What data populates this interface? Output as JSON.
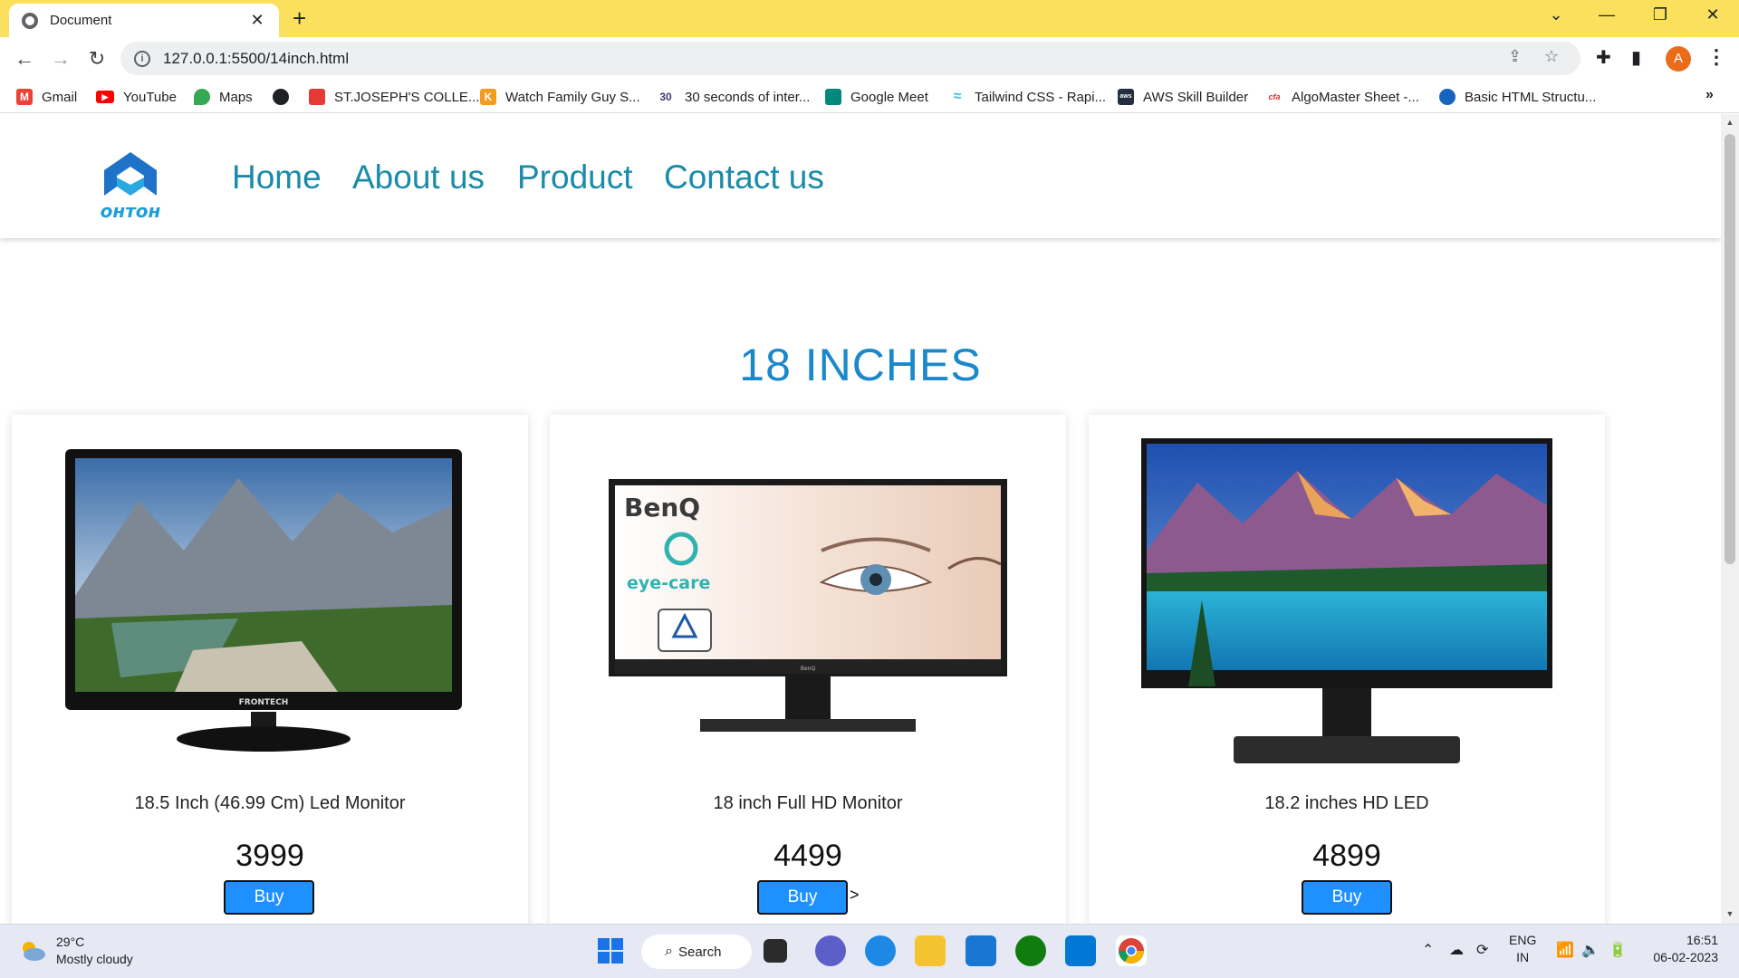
{
  "browser": {
    "tab_title": "Document",
    "url": "127.0.0.1:5500/14inch.html",
    "profile_initial": "A",
    "bookmarks": [
      {
        "label": "Gmail",
        "icon": "gmail-icon",
        "color": "#ea4335"
      },
      {
        "label": "YouTube",
        "icon": "youtube-icon",
        "color": "#ff0000"
      },
      {
        "label": "Maps",
        "icon": "maps-icon",
        "color": "#34a853"
      },
      {
        "label": "",
        "icon": "globe-icon",
        "color": "#202124"
      },
      {
        "label": "ST.JOSEPH'S COLLE...",
        "icon": "college-icon",
        "color": "#e53935"
      },
      {
        "label": "Watch Family Guy S...",
        "icon": "k-icon",
        "color": "#f29b1d"
      },
      {
        "label": "30 seconds of inter...",
        "icon": "30-icon",
        "color": "#3b3b6d",
        "icon_text": "30"
      },
      {
        "label": "Google Meet",
        "icon": "meet-icon",
        "color": "#00897b"
      },
      {
        "label": "Tailwind CSS - Rapi...",
        "icon": "tailwind-icon",
        "color": "#38bdf8"
      },
      {
        "label": "AWS Skill Builder",
        "icon": "aws-icon",
        "color": "#232f3e"
      },
      {
        "label": "AlgoMaster Sheet -...",
        "icon": "cfa-icon",
        "color": "#d32f2f",
        "icon_text": "cfa"
      },
      {
        "label": "Basic HTML Structu...",
        "icon": "html-icon",
        "color": "#1565c0"
      }
    ]
  },
  "site": {
    "logo_text": "онтон",
    "nav": [
      "Home",
      "About us",
      "Product",
      "Contact us"
    ],
    "headline": "18 INCHES",
    "link_color": "#1a8ba8",
    "headline_color": "#1a88c9",
    "button_color": "#1e90ff",
    "products": [
      {
        "name": "18.5 Inch (46.99 Cm) Led Monitor",
        "price": "3999",
        "buy_label": "Buy",
        "brand_on_bezel": "FRONTECH"
      },
      {
        "name": "18 inch Full HD Monitor",
        "price": "4499",
        "buy_label": "Buy",
        "brand_on_screen": "BenQ",
        "screen_badge": "eye-care",
        "bezel_brand": "BenQ"
      },
      {
        "name": "18.2 inches HD LED",
        "price": "4899",
        "buy_label": "Buy"
      }
    ],
    "stray_text": ">"
  },
  "taskbar": {
    "weather_temp": "29°C",
    "weather_desc": "Mostly cloudy",
    "search_label": "Search",
    "lang_top": "ENG",
    "lang_bottom": "IN",
    "time": "16:51",
    "date": "06-02-2023"
  }
}
